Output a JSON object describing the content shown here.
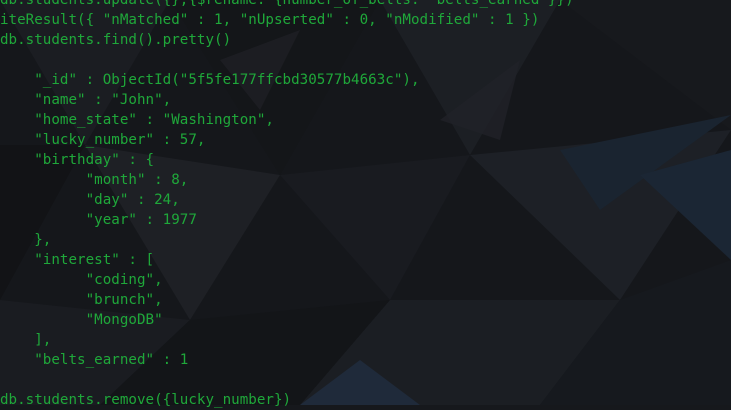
{
  "terminal": {
    "lines": [
      "db.students.update({},{$rename: {number_of_belts: \"belts_earned\"}})",
      "iteResult({ \"nMatched\" : 1, \"nUpserted\" : 0, \"nModified\" : 1 })",
      "db.students.find().pretty()",
      "",
      "    \"_id\" : ObjectId(\"5f5fe177ffcbd30577b4663c\"),",
      "    \"name\" : \"John\",",
      "    \"home_state\" : \"Washington\",",
      "    \"lucky_number\" : 57,",
      "    \"birthday\" : {",
      "          \"month\" : 8,",
      "          \"day\" : 24,",
      "          \"year\" : 1977",
      "    },",
      "    \"interest\" : [",
      "          \"coding\",",
      "          \"brunch\",",
      "          \"MongoDB\"",
      "    ],",
      "    \"belts_earned\" : 1",
      "",
      "db.students.remove({lucky_number})"
    ]
  },
  "colors": {
    "text": "#1fa83a",
    "background": "#16181c"
  }
}
